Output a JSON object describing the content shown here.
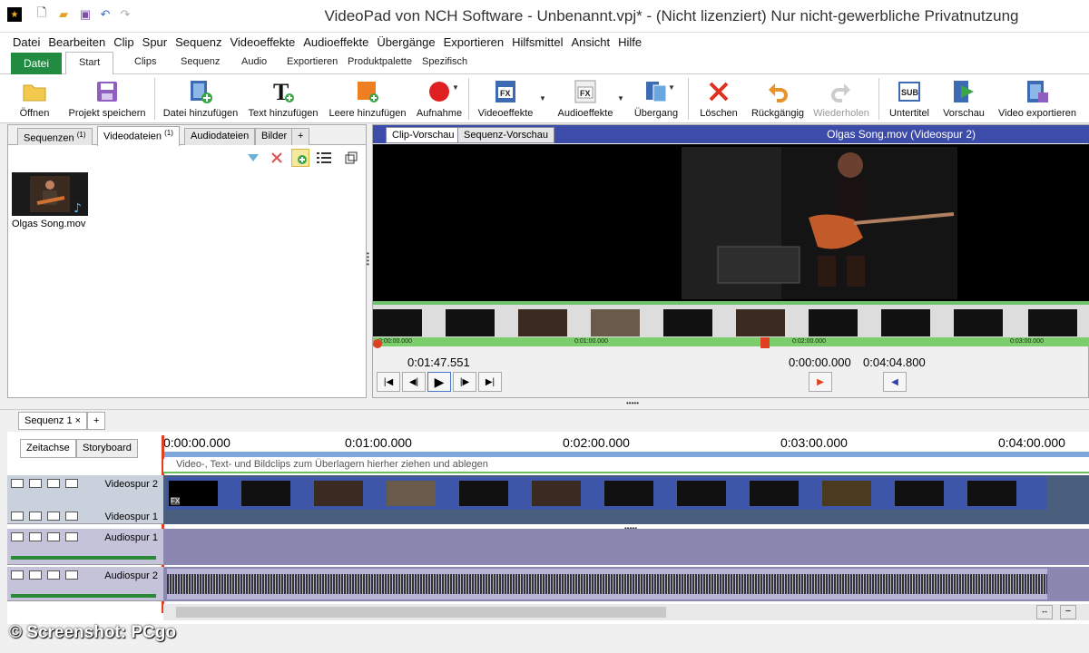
{
  "window": {
    "title": "VideoPad von NCH Software - Unbenannt.vpj* - (Nicht lizenziert) Nur nicht-gewerbliche Privatnutzung"
  },
  "menu": [
    "Datei",
    "Bearbeiten",
    "Clip",
    "Spur",
    "Sequenz",
    "Videoeffekte",
    "Audioeffekte",
    "Übergänge",
    "Exportieren",
    "Hilfsmittel",
    "Ansicht",
    "Hilfe"
  ],
  "ribbon_tabs": {
    "file": "Datei",
    "tabs": [
      "Start",
      "Clips",
      "Sequenz",
      "Audio",
      "Exportieren",
      "Produktpalette",
      "Spezifisch"
    ],
    "active": "Start"
  },
  "toolbar": {
    "open": "Öffnen",
    "save": "Projekt speichern",
    "add_file": "Datei hinzufügen",
    "add_text": "Text hinzufügen",
    "add_blank": "Leere hinzufügen",
    "record": "Aufnahme",
    "video_fx": "Videoeffekte",
    "audio_fx": "Audioeffekte",
    "transition": "Übergang",
    "delete": "Löschen",
    "undo": "Rückgängig",
    "redo": "Wiederholen",
    "subtitle": "Untertitel",
    "preview": "Vorschau",
    "export": "Video exportieren",
    "subtitle_icon_text": "SUB",
    "fx_icon_text": "FX"
  },
  "media_tabs": {
    "sequences": "Sequenzen",
    "sequences_count": "(1)",
    "videos": "Videodateien",
    "videos_count": "(1)",
    "audio": "Audiodateien",
    "images": "Bilder",
    "add": "+"
  },
  "media_items": [
    {
      "name": "Olgas Song.mov"
    }
  ],
  "preview": {
    "tab_clip": "Clip-Vorschau",
    "tab_sequence": "Sequenz-Vorschau",
    "clip_title": "Olgas Song.mov (Videospur 2)",
    "current_time": "0:01:47.551",
    "in_time": "0:00:00.000",
    "out_time": "0:04:04.800",
    "strip_ticks": [
      "0:00:00.000",
      "0:01:00.000",
      "0:02:00.000",
      "0:03:00.000"
    ]
  },
  "sequence_tabs": {
    "name": "Sequenz 1",
    "close": "×",
    "add": "+"
  },
  "timeline": {
    "tab_timeline": "Zeitachse",
    "tab_storyboard": "Storyboard",
    "ruler": [
      "0:00:00.000",
      "0:01:00.000",
      "0:02:00.000",
      "0:03:00.000",
      "0:04:00.000"
    ],
    "overlay_hint": "Video-, Text- und Bildclips zum Überlagern hierher ziehen und ablegen",
    "tracks": {
      "video2": "Videospur 2",
      "video1": "Videospur 1",
      "audio1": "Audiospur 1",
      "audio2": "Audiospur 2"
    }
  },
  "watermark": "© Screenshot: PCgo",
  "colors": {
    "brand_green": "#218c41",
    "preview_header": "#3d4ca8",
    "track_blue": "#3d56a8",
    "audio_purple": "#8a87b0"
  }
}
